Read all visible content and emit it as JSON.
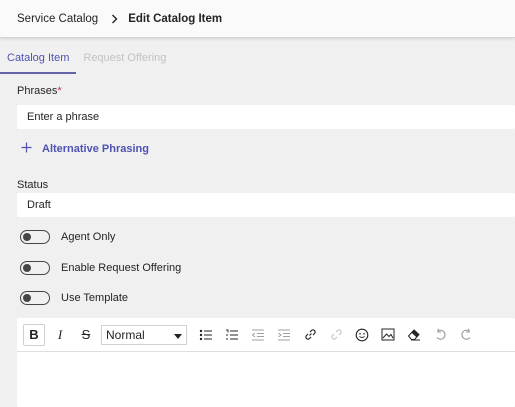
{
  "breadcrumb": {
    "parent": "Service Catalog",
    "current": "Edit Catalog Item"
  },
  "tabs": [
    {
      "label": "Catalog Item",
      "active": true
    },
    {
      "label": "Request Offering",
      "active": false
    }
  ],
  "phrases": {
    "label": "Phrases",
    "required_mark": "*",
    "placeholder": "Enter a phrase"
  },
  "alt_phrasing": {
    "label": "Alternative Phrasing"
  },
  "status": {
    "label": "Status",
    "value": "Draft"
  },
  "toggles": [
    {
      "label": "Agent Only",
      "on": false
    },
    {
      "label": "Enable Request Offering",
      "on": false
    },
    {
      "label": "Use Template",
      "on": false
    }
  ],
  "editor": {
    "format_select": "Normal",
    "icons": [
      "bold-icon",
      "italic-icon",
      "strikethrough-icon",
      "bullet-list-icon",
      "numbered-list-icon",
      "outdent-icon",
      "indent-icon",
      "link-icon",
      "unlink-icon",
      "emoji-icon",
      "image-icon",
      "clear-format-icon",
      "undo-icon",
      "redo-icon"
    ]
  },
  "colors": {
    "accent": "#6264a7",
    "accent_text": "#4f52b2",
    "required": "#c4314b"
  }
}
